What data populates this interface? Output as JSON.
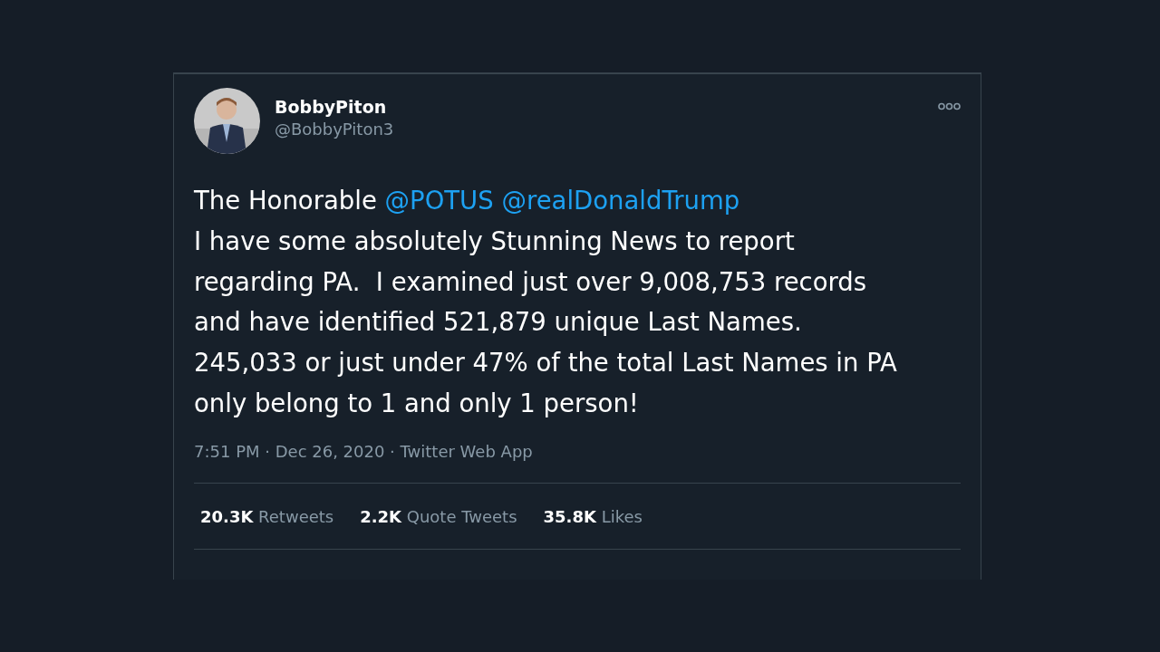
{
  "author": {
    "name": "BobbyPiton",
    "handle": "@BobbyPiton3"
  },
  "tweet": {
    "lines": [
      [
        {
          "kind": "text",
          "text": "The Honorable"
        },
        {
          "kind": "mention",
          "text": "@POTUS"
        },
        {
          "kind": "mention",
          "text": "@realDonaldTrump"
        }
      ],
      [
        {
          "kind": "text",
          "text": "I have some absolutely Stunning News to report"
        }
      ],
      [
        {
          "kind": "text",
          "text": "regarding PA.  I examined just over 9,008,753 records"
        }
      ],
      [
        {
          "kind": "text",
          "text": "and have identified 521,879 unique Last Names."
        }
      ],
      [
        {
          "kind": "text",
          "text": "245,033 or just under 47% of the total Last Names in PA"
        }
      ],
      [
        {
          "kind": "text",
          "text": "only belong to 1 and only 1 person!"
        }
      ]
    ]
  },
  "meta": "7:51 PM · Dec 26, 2020 · Twitter Web App",
  "stats": [
    {
      "count": "20.3K",
      "label": "Retweets"
    },
    {
      "count": "2.2K",
      "label": "Quote Tweets"
    },
    {
      "count": "35.8K",
      "label": "Likes"
    }
  ]
}
